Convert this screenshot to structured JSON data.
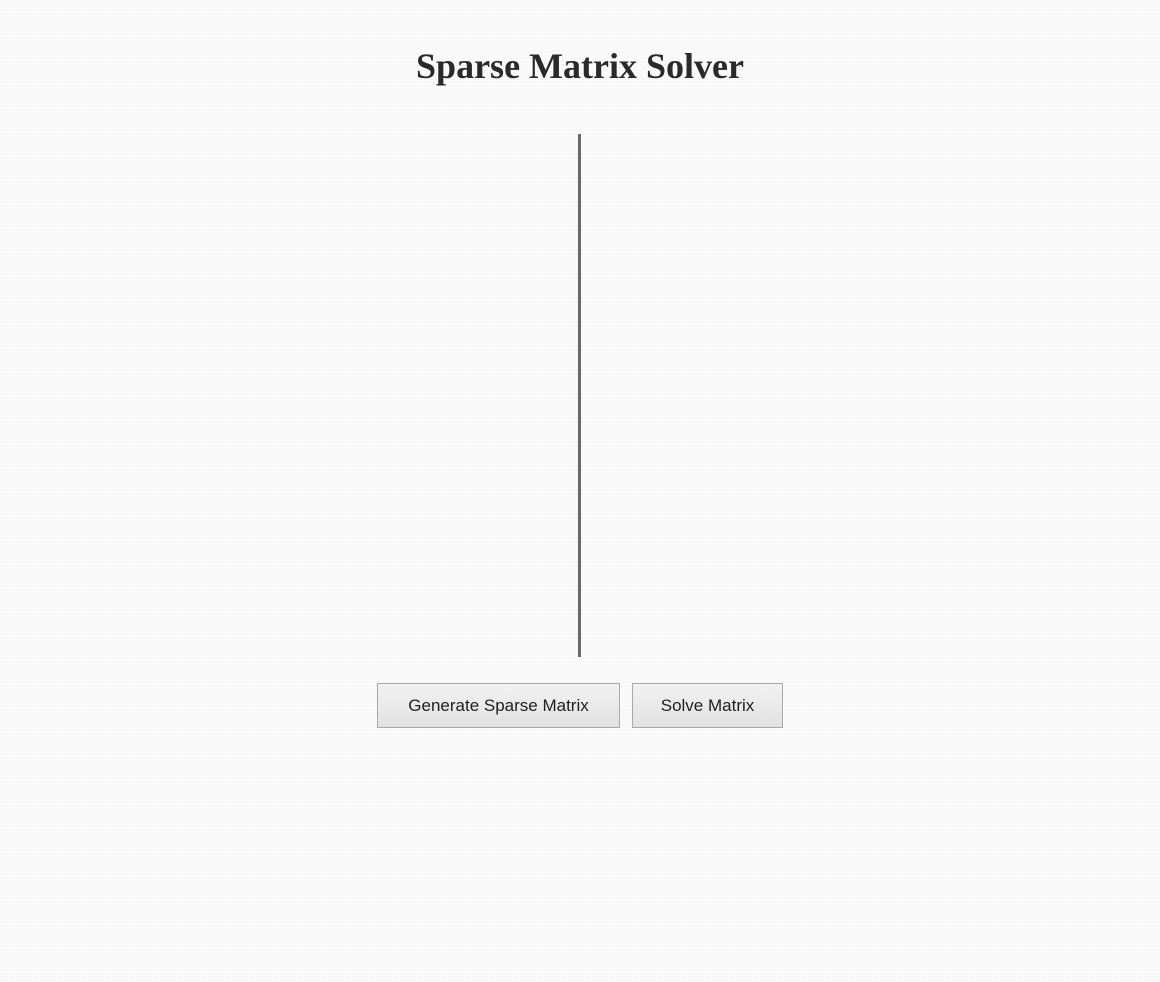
{
  "page": {
    "title": "Sparse Matrix Solver"
  },
  "buttons": {
    "generate_label": "Generate Sparse Matrix",
    "solve_label": "Solve Matrix"
  },
  "colors": {
    "background": "#fafafa",
    "title_text": "#2a2a2a",
    "matrix_line": "#6b6b66",
    "button_border": "#a9a9a9"
  }
}
